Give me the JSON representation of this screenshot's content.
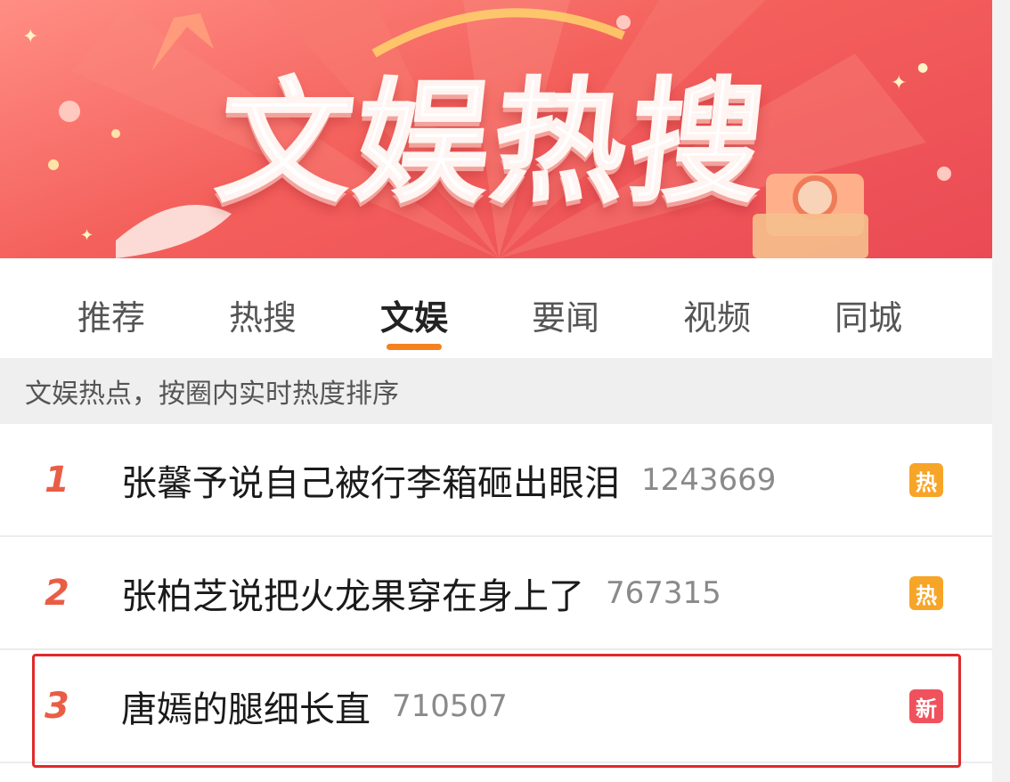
{
  "banner": {
    "title": "文娱热搜"
  },
  "tabs": [
    {
      "label": "推荐"
    },
    {
      "label": "热搜"
    },
    {
      "label": "文娱"
    },
    {
      "label": "要闻"
    },
    {
      "label": "视频"
    },
    {
      "label": "同城"
    }
  ],
  "active_tab": "文娱",
  "subtitle": "文娱热点，按圈内实时热度排序",
  "list": [
    {
      "rank": "1",
      "topic": "张馨予说自己被行李箱砸出眼泪",
      "count": "1243669",
      "badge": "热",
      "badge_type": "hot"
    },
    {
      "rank": "2",
      "topic": "张柏芝说把火龙果穿在身上了",
      "count": "767315",
      "badge": "热",
      "badge_type": "hot"
    },
    {
      "rank": "3",
      "topic": "唐嫣的腿细长直",
      "count": "710507",
      "badge": "新",
      "badge_type": "new"
    }
  ],
  "colors": {
    "accent": "#f5821f",
    "rank": "#ea5d45",
    "hot_badge": "#f7a528",
    "new_badge": "#f0525d",
    "highlight_border": "#e02a2a"
  }
}
